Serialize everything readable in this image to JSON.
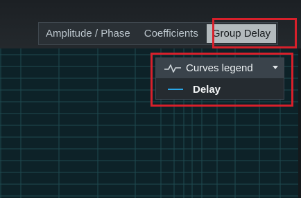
{
  "toolbar": {
    "tabs": [
      {
        "label": "Amplitude / Phase",
        "selected": false
      },
      {
        "label": "Coefficients",
        "selected": false
      },
      {
        "label": "Group Delay",
        "selected": true
      }
    ]
  },
  "legend": {
    "icon": "curve-wave-icon",
    "title": "Curves legend",
    "expanded": true,
    "items": [
      {
        "label": "Delay",
        "color": "#2aa7e8"
      }
    ]
  },
  "colors": {
    "highlight": "#d8202b",
    "plot_background": "#0d2228",
    "grid": "#1f4a50"
  }
}
